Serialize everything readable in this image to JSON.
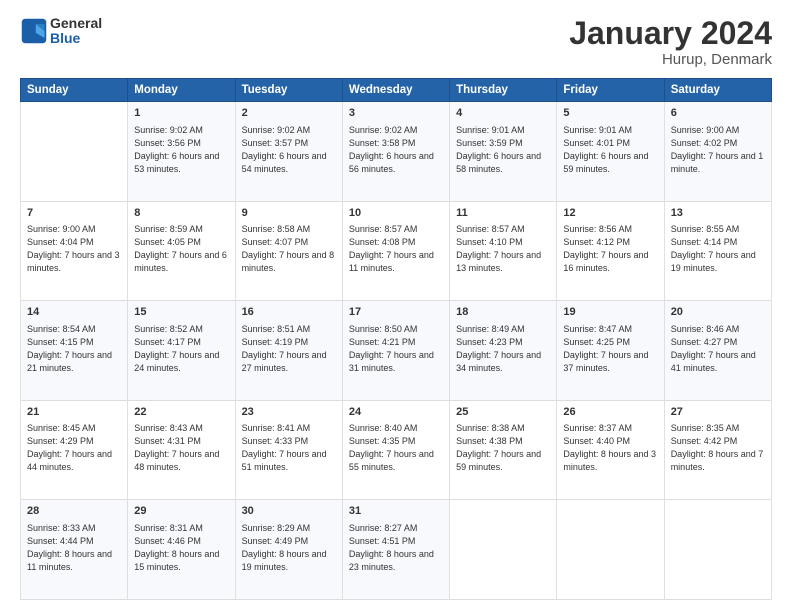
{
  "logo": {
    "text_general": "General",
    "text_blue": "Blue"
  },
  "title": "January 2024",
  "subtitle": "Hurup, Denmark",
  "headers": [
    "Sunday",
    "Monday",
    "Tuesday",
    "Wednesday",
    "Thursday",
    "Friday",
    "Saturday"
  ],
  "weeks": [
    [
      {
        "day": "",
        "sunrise": "",
        "sunset": "",
        "daylight": ""
      },
      {
        "day": "1",
        "sunrise": "Sunrise: 9:02 AM",
        "sunset": "Sunset: 3:56 PM",
        "daylight": "Daylight: 6 hours and 53 minutes."
      },
      {
        "day": "2",
        "sunrise": "Sunrise: 9:02 AM",
        "sunset": "Sunset: 3:57 PM",
        "daylight": "Daylight: 6 hours and 54 minutes."
      },
      {
        "day": "3",
        "sunrise": "Sunrise: 9:02 AM",
        "sunset": "Sunset: 3:58 PM",
        "daylight": "Daylight: 6 hours and 56 minutes."
      },
      {
        "day": "4",
        "sunrise": "Sunrise: 9:01 AM",
        "sunset": "Sunset: 3:59 PM",
        "daylight": "Daylight: 6 hours and 58 minutes."
      },
      {
        "day": "5",
        "sunrise": "Sunrise: 9:01 AM",
        "sunset": "Sunset: 4:01 PM",
        "daylight": "Daylight: 6 hours and 59 minutes."
      },
      {
        "day": "6",
        "sunrise": "Sunrise: 9:00 AM",
        "sunset": "Sunset: 4:02 PM",
        "daylight": "Daylight: 7 hours and 1 minute."
      }
    ],
    [
      {
        "day": "7",
        "sunrise": "Sunrise: 9:00 AM",
        "sunset": "Sunset: 4:04 PM",
        "daylight": "Daylight: 7 hours and 3 minutes."
      },
      {
        "day": "8",
        "sunrise": "Sunrise: 8:59 AM",
        "sunset": "Sunset: 4:05 PM",
        "daylight": "Daylight: 7 hours and 6 minutes."
      },
      {
        "day": "9",
        "sunrise": "Sunrise: 8:58 AM",
        "sunset": "Sunset: 4:07 PM",
        "daylight": "Daylight: 7 hours and 8 minutes."
      },
      {
        "day": "10",
        "sunrise": "Sunrise: 8:57 AM",
        "sunset": "Sunset: 4:08 PM",
        "daylight": "Daylight: 7 hours and 11 minutes."
      },
      {
        "day": "11",
        "sunrise": "Sunrise: 8:57 AM",
        "sunset": "Sunset: 4:10 PM",
        "daylight": "Daylight: 7 hours and 13 minutes."
      },
      {
        "day": "12",
        "sunrise": "Sunrise: 8:56 AM",
        "sunset": "Sunset: 4:12 PM",
        "daylight": "Daylight: 7 hours and 16 minutes."
      },
      {
        "day": "13",
        "sunrise": "Sunrise: 8:55 AM",
        "sunset": "Sunset: 4:14 PM",
        "daylight": "Daylight: 7 hours and 19 minutes."
      }
    ],
    [
      {
        "day": "14",
        "sunrise": "Sunrise: 8:54 AM",
        "sunset": "Sunset: 4:15 PM",
        "daylight": "Daylight: 7 hours and 21 minutes."
      },
      {
        "day": "15",
        "sunrise": "Sunrise: 8:52 AM",
        "sunset": "Sunset: 4:17 PM",
        "daylight": "Daylight: 7 hours and 24 minutes."
      },
      {
        "day": "16",
        "sunrise": "Sunrise: 8:51 AM",
        "sunset": "Sunset: 4:19 PM",
        "daylight": "Daylight: 7 hours and 27 minutes."
      },
      {
        "day": "17",
        "sunrise": "Sunrise: 8:50 AM",
        "sunset": "Sunset: 4:21 PM",
        "daylight": "Daylight: 7 hours and 31 minutes."
      },
      {
        "day": "18",
        "sunrise": "Sunrise: 8:49 AM",
        "sunset": "Sunset: 4:23 PM",
        "daylight": "Daylight: 7 hours and 34 minutes."
      },
      {
        "day": "19",
        "sunrise": "Sunrise: 8:47 AM",
        "sunset": "Sunset: 4:25 PM",
        "daylight": "Daylight: 7 hours and 37 minutes."
      },
      {
        "day": "20",
        "sunrise": "Sunrise: 8:46 AM",
        "sunset": "Sunset: 4:27 PM",
        "daylight": "Daylight: 7 hours and 41 minutes."
      }
    ],
    [
      {
        "day": "21",
        "sunrise": "Sunrise: 8:45 AM",
        "sunset": "Sunset: 4:29 PM",
        "daylight": "Daylight: 7 hours and 44 minutes."
      },
      {
        "day": "22",
        "sunrise": "Sunrise: 8:43 AM",
        "sunset": "Sunset: 4:31 PM",
        "daylight": "Daylight: 7 hours and 48 minutes."
      },
      {
        "day": "23",
        "sunrise": "Sunrise: 8:41 AM",
        "sunset": "Sunset: 4:33 PM",
        "daylight": "Daylight: 7 hours and 51 minutes."
      },
      {
        "day": "24",
        "sunrise": "Sunrise: 8:40 AM",
        "sunset": "Sunset: 4:35 PM",
        "daylight": "Daylight: 7 hours and 55 minutes."
      },
      {
        "day": "25",
        "sunrise": "Sunrise: 8:38 AM",
        "sunset": "Sunset: 4:38 PM",
        "daylight": "Daylight: 7 hours and 59 minutes."
      },
      {
        "day": "26",
        "sunrise": "Sunrise: 8:37 AM",
        "sunset": "Sunset: 4:40 PM",
        "daylight": "Daylight: 8 hours and 3 minutes."
      },
      {
        "day": "27",
        "sunrise": "Sunrise: 8:35 AM",
        "sunset": "Sunset: 4:42 PM",
        "daylight": "Daylight: 8 hours and 7 minutes."
      }
    ],
    [
      {
        "day": "28",
        "sunrise": "Sunrise: 8:33 AM",
        "sunset": "Sunset: 4:44 PM",
        "daylight": "Daylight: 8 hours and 11 minutes."
      },
      {
        "day": "29",
        "sunrise": "Sunrise: 8:31 AM",
        "sunset": "Sunset: 4:46 PM",
        "daylight": "Daylight: 8 hours and 15 minutes."
      },
      {
        "day": "30",
        "sunrise": "Sunrise: 8:29 AM",
        "sunset": "Sunset: 4:49 PM",
        "daylight": "Daylight: 8 hours and 19 minutes."
      },
      {
        "day": "31",
        "sunrise": "Sunrise: 8:27 AM",
        "sunset": "Sunset: 4:51 PM",
        "daylight": "Daylight: 8 hours and 23 minutes."
      },
      {
        "day": "",
        "sunrise": "",
        "sunset": "",
        "daylight": ""
      },
      {
        "day": "",
        "sunrise": "",
        "sunset": "",
        "daylight": ""
      },
      {
        "day": "",
        "sunrise": "",
        "sunset": "",
        "daylight": ""
      }
    ]
  ]
}
